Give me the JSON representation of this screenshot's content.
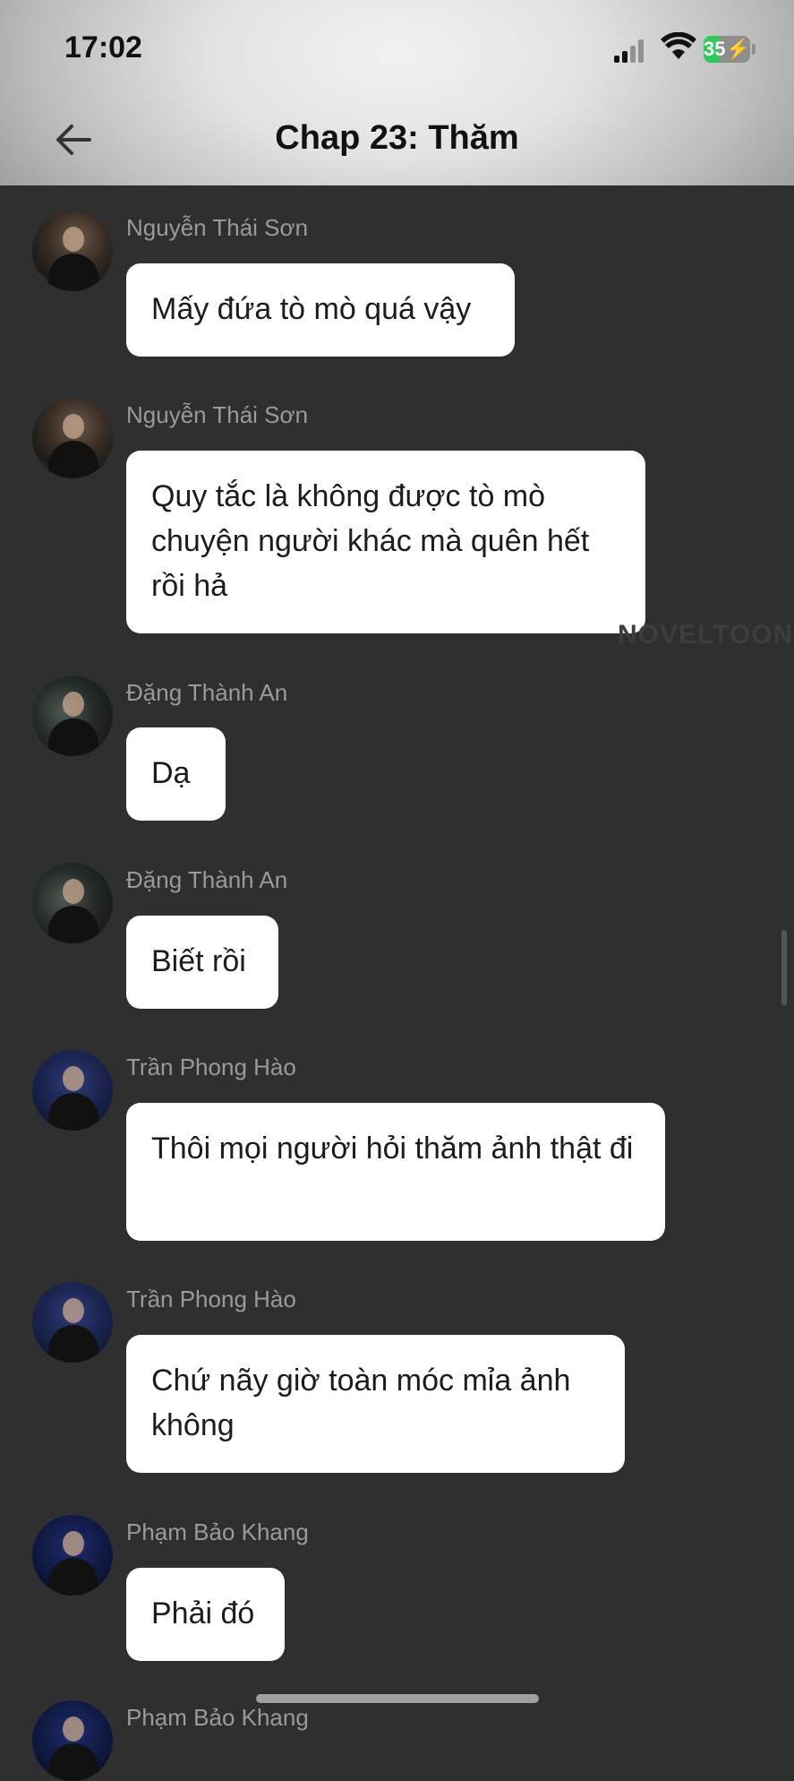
{
  "status_bar": {
    "time": "17:02",
    "battery_percent": "35",
    "battery_level": 0.35,
    "icons": [
      "signal-icon",
      "wifi-icon",
      "battery-charging-icon"
    ]
  },
  "header": {
    "title": "Chap 23: Thăm",
    "back_icon": "arrow-left-icon"
  },
  "watermark": "NOVELTOON",
  "messages": [
    {
      "author": "Nguyễn Thái Sơn",
      "text": "Mấy đứa tò mò quá vậy"
    },
    {
      "author": "Nguyễn Thái Sơn",
      "text": "Quy tắc là không được tò mò chuyện người khác mà quên hết rồi hả"
    },
    {
      "author": "Đặng Thành An",
      "text": "Dạ"
    },
    {
      "author": "Đặng Thành An",
      "text": "Biết rồi"
    },
    {
      "author": "Trần Phong Hào",
      "text": "Thôi mọi người hỏi thăm ảnh thật đi"
    },
    {
      "author": "Trần Phong Hào",
      "text": "Chứ nãy giờ toàn móc mỉa ảnh không"
    },
    {
      "author": "Phạm Bảo Khang",
      "text": "Phải đó"
    },
    {
      "author": "Phạm Bảo Khang",
      "text": ""
    }
  ],
  "colors": {
    "background": "#2f2f2f",
    "bubble": "#ffffff",
    "author_name": "#9a9a9a",
    "battery_fill": "#34c759"
  }
}
